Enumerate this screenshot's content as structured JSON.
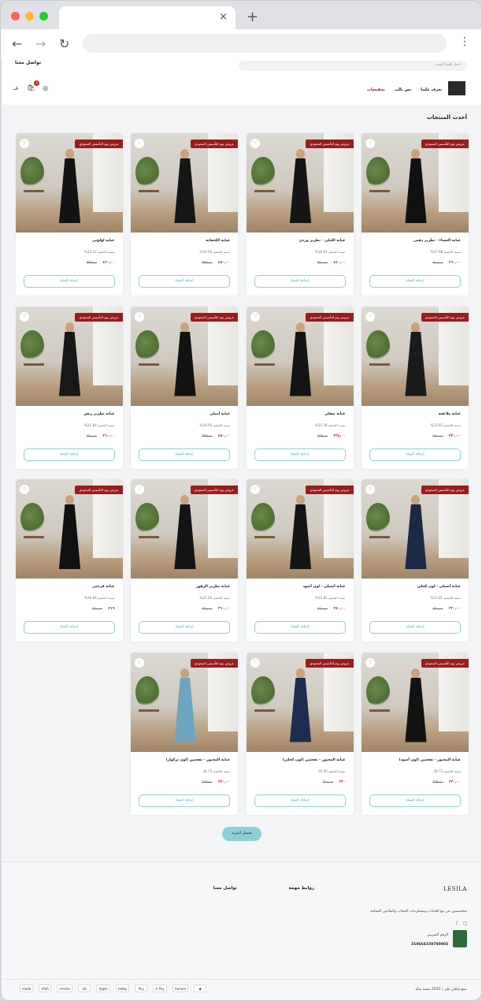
{
  "browser": {
    "tab_close": "×",
    "new_tab": "+",
    "back": "←",
    "forward": "→",
    "reload": "↻",
    "menu": "⋮"
  },
  "topbar": {
    "contact": "تواصل معنا",
    "search_placeholder": "ادخل كلمة البحث"
  },
  "nav": {
    "items": [
      "تعرف علينا",
      "نص بالت",
      "تخفيضات"
    ],
    "active_index": 2
  },
  "cart": {
    "count": "0"
  },
  "lang": "عـ",
  "section_title": "أحدث المنتجات",
  "ribbon": "عروض يوم التأسيس السعودي",
  "add_to_cart": "إضافة للسلة",
  "products": [
    {
      "name": "عباية العساء - تطريز ذهبي",
      "discount": "نسبة الخصم 27.98%",
      "price_new": "٣٦٠,٠٠",
      "price_old": "٥٠٠,٠٠"
    },
    {
      "name": "عباية الليلي - تطريز وردي",
      "discount": "نسبة الخصم 18.62%",
      "price_new": "٤٤٠,٠٠",
      "price_old": "٥٤٠,٠٠"
    },
    {
      "name": "عباية اللحفاية",
      "discount": "نسبة الخصم 18.92%",
      "price_new": "٤٥٠,٠٠",
      "price_old": "٥٥٥,٠٠"
    },
    {
      "name": "عباية لؤلؤتي",
      "discount": "نسبة الخصم 24.32%",
      "price_new": "٤٢٠,٠٠",
      "price_old": "٥٥٥,٠٠"
    },
    {
      "name": "عباية ملاعجة",
      "discount": "نسبة الخصم 23.81%",
      "price_new": "٣٢٠,٠٠",
      "price_old": "٤٢٠,٠٠"
    },
    {
      "name": "عباية تنفلي",
      "discount": "نسبة الخصم 25.38%",
      "price_new": "٣٣٨,٠٠",
      "price_old": "٤٥٣,٠٠"
    },
    {
      "name": "عباية أميلي",
      "discount": "نسبة الخصم 18.92%",
      "price_new": "٤٥٠,٠٠",
      "price_old": "٥٥٥,٠٠"
    },
    {
      "name": "عباية تطريز ريش",
      "discount": "نسبة الخصم 21.84%",
      "price_new": "٣٦٠,٠٠",
      "price_old": "٤٦٠,٠٠"
    },
    {
      "name": "عباية أسيلي - لون كحلي",
      "discount": "نسبة الخصم 23.81%",
      "price_new": "٣٢٠,٠٠",
      "price_old": "٤٢٠,٠٠"
    },
    {
      "name": "عباية أسيلي - لون أسود",
      "discount": "نسبة الخصم 23.85%",
      "price_new": "٣٥٠,٠٠",
      "price_old": "٤٦٠,٠٠"
    },
    {
      "name": "عباية تطريز الزهور",
      "discount": "نسبة الخصم 21.84%",
      "price_new": "٣٦٠,٠٠",
      "price_old": "٤٦٠,٠٠"
    },
    {
      "name": "عباية فرحتي",
      "discount": "نسبة الخصم 30.86%",
      "price_new": "٣١٩",
      "price_old": "٤٦٠,٠٠"
    },
    {
      "name": "عباية المجبور - تفحتين (لون أسود)",
      "discount": "نسبة الخصم 28.73",
      "price_new": "٣٣٠,٠٠",
      "price_old": "٤٦٣,٠٠"
    },
    {
      "name": "عباية المجبور - تفحتين (لون كحلي)",
      "discount": "نسبة الخصم 28.50",
      "price_new": "٣٣٠",
      "price_old": "٤٦٠,٠٠"
    },
    {
      "name": "عباية المجبور - تفحتين (لون تركواز)",
      "discount": "نسبة الخصم 28.73",
      "price_new": "٣٣٠,٠٠",
      "price_old": "٤٦٣,٠٠"
    }
  ],
  "load_more": "تحميل المزيد",
  "footer": {
    "brand": "LESILA",
    "links_title": "روابط مهمة",
    "contact_title": "تواصل معنا",
    "description": "متخصصون في بيع العبايات ومستلزمات الحجاب والملابس النسائية",
    "vat_label": "الرقم الضريبي",
    "vat_number": "310664159700003",
    "copyright": "صنع بإتقان على | 2025 منصة سلة",
    "payments": [
      "mada",
      "VISA",
      "master",
      "stc",
      "Apple",
      "tabby",
      "Pay",
      "G Pay",
      "tamara",
      "◆"
    ]
  }
}
